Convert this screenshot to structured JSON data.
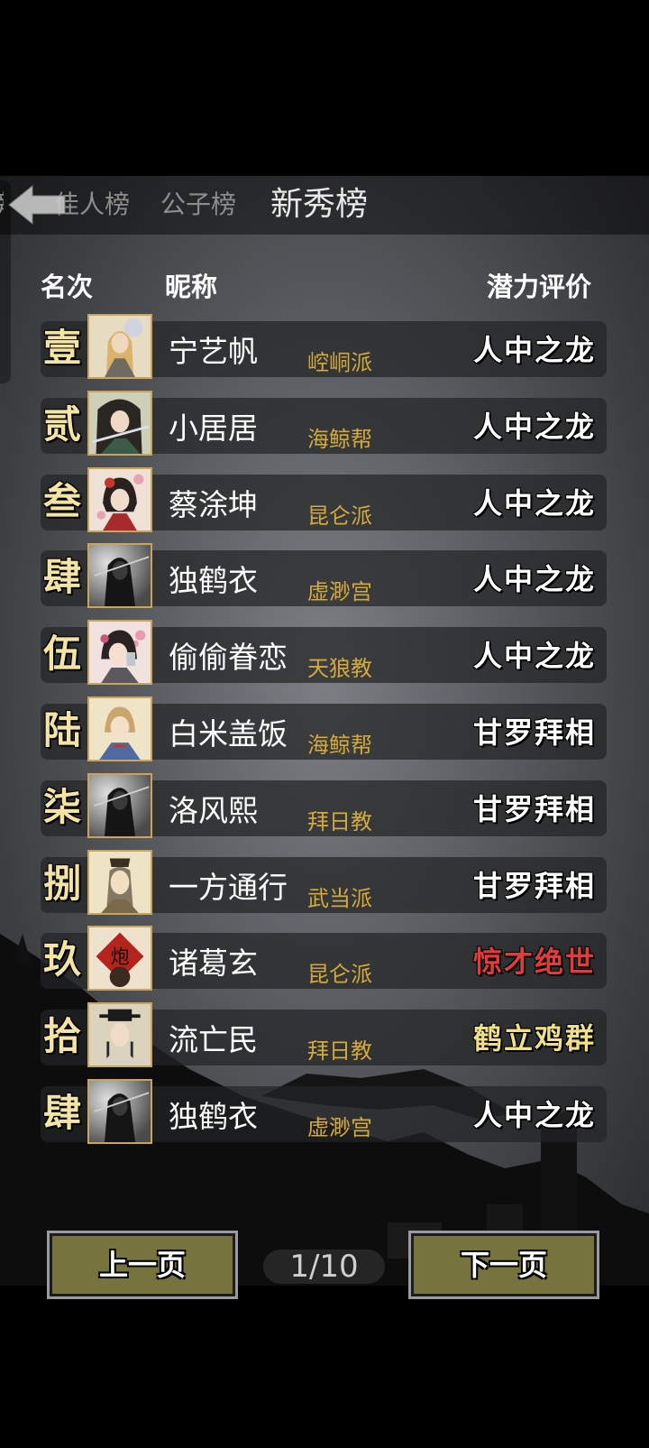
{
  "tabs": [
    {
      "label": "榜"
    },
    {
      "label": "佳人榜"
    },
    {
      "label": "公子榜"
    },
    {
      "label": "新秀榜"
    }
  ],
  "headers": {
    "rank": "名次",
    "nickname": "昵称",
    "potential": "潜力评价"
  },
  "colors": {
    "rank_text": "#f3e3a4",
    "sect_text": "#d4a93d",
    "potential_default": "#ffffff",
    "potential_red": "#e13c3c",
    "potential_gold": "#f1df8a",
    "button_fill": "#77733e"
  },
  "rows": [
    {
      "rank": "壹",
      "name": "宁艺帆",
      "sect": "崆峒派",
      "potential": "人中之龙",
      "potential_color": "#ffffff",
      "avatar": "female-blonde-portrait"
    },
    {
      "rank": "贰",
      "name": "小居居",
      "sect": "海鲸帮",
      "potential": "人中之龙",
      "potential_color": "#ffffff",
      "avatar": "swordswoman-portrait"
    },
    {
      "rank": "叁",
      "name": "蔡涂坤",
      "sect": "昆仑派",
      "potential": "人中之龙",
      "potential_color": "#ffffff",
      "avatar": "flower-girl-portrait"
    },
    {
      "rank": "肆",
      "name": "独鹤衣",
      "sect": "虚渺宫",
      "potential": "人中之龙",
      "potential_color": "#ffffff",
      "avatar": "ink-swordsman-portrait"
    },
    {
      "rank": "伍",
      "name": "偷偷眷恋",
      "sect": "天狼教",
      "potential": "人中之龙",
      "potential_color": "#ffffff",
      "avatar": "blossom-lady-portrait"
    },
    {
      "rank": "陆",
      "name": "白米盖饭",
      "sect": "海鲸帮",
      "potential": "甘罗拜相",
      "potential_color": "#ffffff",
      "avatar": "young-hero-portrait"
    },
    {
      "rank": "柒",
      "name": "洛风熙",
      "sect": "拜日教",
      "potential": "甘罗拜相",
      "potential_color": "#ffffff",
      "avatar": "ink-swordsman-portrait"
    },
    {
      "rank": "捌",
      "name": "一方通行",
      "sect": "武当派",
      "potential": "甘罗拜相",
      "potential_color": "#ffffff",
      "avatar": "scholar-portrait"
    },
    {
      "rank": "玖",
      "name": "诸葛玄",
      "sect": "昆仑派",
      "potential": "惊才绝世",
      "potential_color": "#e13c3c",
      "avatar": "red-seal-portrait"
    },
    {
      "rank": "拾",
      "name": "流亡民",
      "sect": "拜日教",
      "potential": "鹤立鸡群",
      "potential_color": "#f1df8a",
      "avatar": "official-portrait"
    },
    {
      "rank": "肆",
      "name": "独鹤衣",
      "sect": "虚渺宫",
      "potential": "人中之龙",
      "potential_color": "#ffffff",
      "avatar": "ink-swordsman-portrait"
    }
  ],
  "pagination": {
    "prev_label": "上一页",
    "next_label": "下一页",
    "indicator": "1/10",
    "current_page": 1,
    "total_pages": 10
  }
}
